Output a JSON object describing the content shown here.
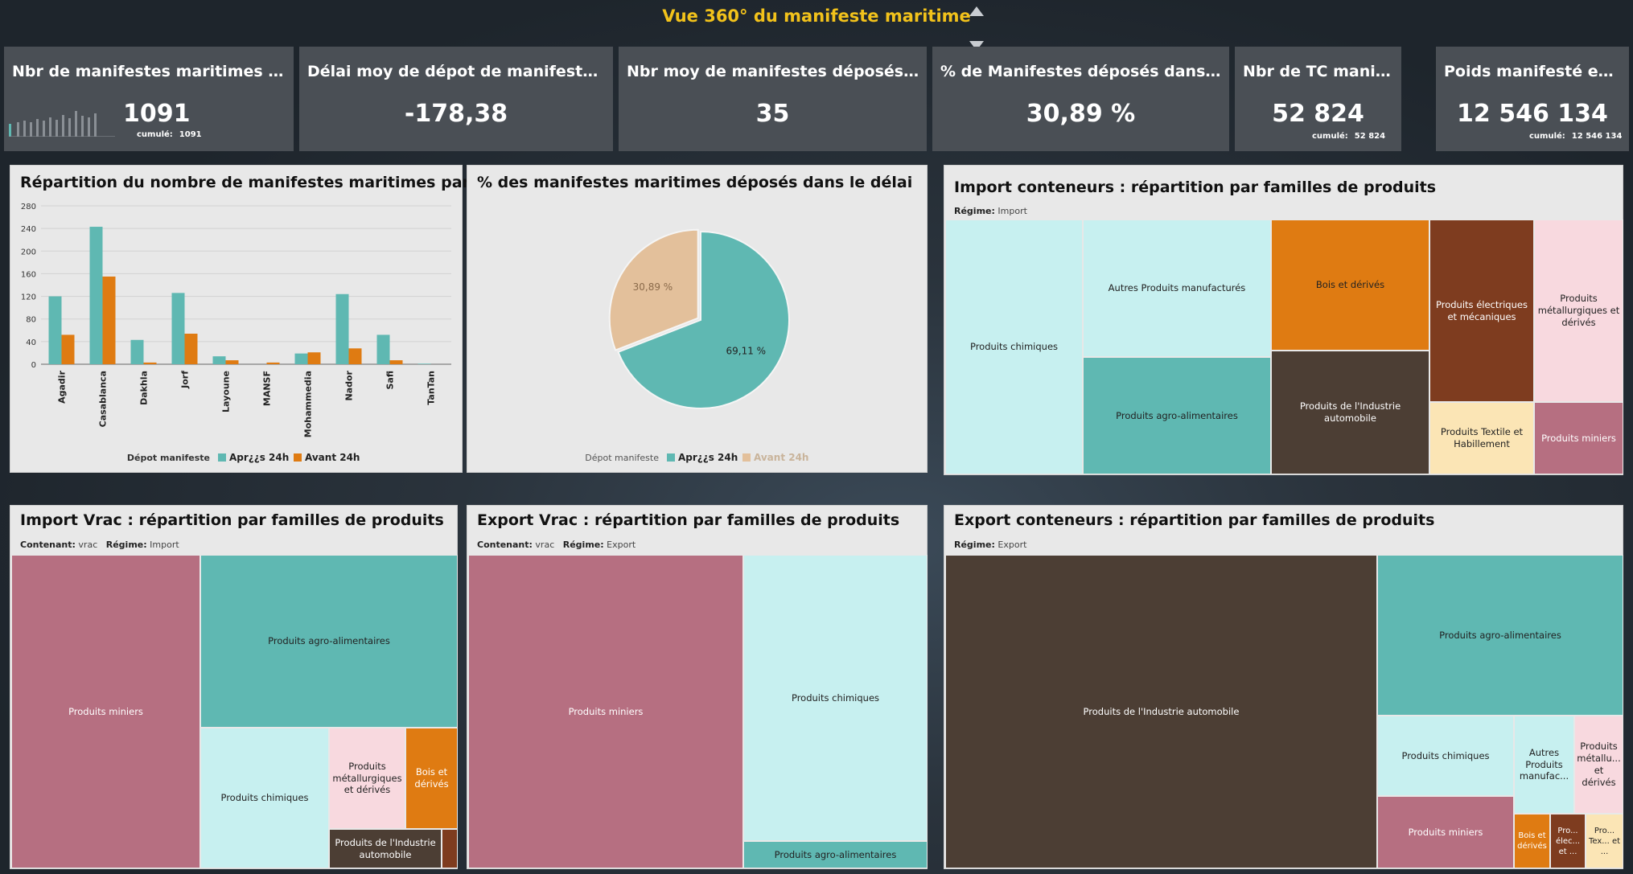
{
  "header": {
    "title": "Vue 360° du manifeste maritime"
  },
  "colors": {
    "teal": "#5fb8b2",
    "orange": "#df7b12",
    "peach": "#e3c09b",
    "pale_cyan": "#c7f0f0",
    "brown": "#7e3c1f",
    "dark_brown": "#4c3e34",
    "pink": "#f8d9df",
    "mauve": "#b66f81",
    "light_yellow": "#fbe5b5",
    "title_yellow": "#f2c21b"
  },
  "kpis": [
    {
      "title": "Nbr de manifestes maritimes dépos...",
      "value": "1091",
      "cumul_label": "cumulé:",
      "cumul_value": "1091"
    },
    {
      "title": "Délai moy de dépot de manifeste en he...",
      "value": "-178,38"
    },
    {
      "title": "Nbr moy de manifestes déposés par jo...",
      "value": "35"
    },
    {
      "title": "% de Manifestes déposés dans le délai",
      "value": "30,89 %"
    },
    {
      "title": "Nbr de TC manifestés",
      "value": "52 824",
      "cumul_label": "cumulé:",
      "cumul_value": "52 824"
    },
    {
      "title": "Poids manifesté en to...",
      "value": "12 546 134",
      "cumul_label": "cumulé:",
      "cumul_value": "12 546 134"
    }
  ],
  "bar_panel": {
    "title": "Répartition du nombre de manifestes maritimes par port",
    "legend_title": "Dépot manifeste",
    "chart_data": {
      "type": "bar",
      "categories": [
        "Agadir",
        "Casablanca",
        "Dakhla",
        "Jorf",
        "Layoune",
        "MANSF",
        "Mohammedia",
        "Nador",
        "Safi",
        "TanTan"
      ],
      "series": [
        {
          "name": "Apr¿¿s 24h",
          "values": [
            120,
            243,
            43,
            126,
            14,
            0,
            19,
            124,
            52,
            1
          ]
        },
        {
          "name": "Avant 24h",
          "values": [
            52,
            155,
            3,
            54,
            7,
            3,
            21,
            28,
            7,
            0
          ]
        }
      ],
      "yticks": [
        0,
        40,
        80,
        120,
        160,
        200,
        240,
        280
      ],
      "ylim": [
        0,
        280
      ],
      "grid": true,
      "legend": "bottom"
    }
  },
  "pie_panel": {
    "title": "% des manifestes maritimes déposés dans le délai",
    "legend_title": "Dépot manifeste",
    "chart_data": {
      "type": "pie",
      "labels": [
        "Apr¿¿s 24h",
        "Avant 24h"
      ],
      "values": [
        69.11,
        30.89
      ],
      "value_labels": [
        "69,11 %",
        "30,89 %"
      ],
      "legend": "bottom"
    }
  },
  "import_cont": {
    "title": "Import conteneurs : répartition par familles de produits",
    "filter_label": "Régime:",
    "filter_value": "Import",
    "tiles": [
      {
        "label": "Produits chimiques"
      },
      {
        "label": "Autres Produits manufacturés"
      },
      {
        "label": "Produits agro-alimentaires"
      },
      {
        "label": "Bois et dérivés"
      },
      {
        "label": "Produits de l'Industrie automobile"
      },
      {
        "label": "Produits électriques et mécaniques"
      },
      {
        "label": "Produits métallurgiques et dérivés"
      },
      {
        "label": "Produits Textile et Habillement"
      },
      {
        "label": "Produits miniers"
      }
    ]
  },
  "import_vrac": {
    "title": "Import Vrac : répartition par familles de produits",
    "filter1_label": "Contenant:",
    "filter1_value": "vrac",
    "filter2_label": "Régime:",
    "filter2_value": "Import",
    "tiles": [
      {
        "label": "Produits miniers"
      },
      {
        "label": "Produits agro-alimentaires"
      },
      {
        "label": "Produits chimiques"
      },
      {
        "label": "Produits métallurgiques et dérivés"
      },
      {
        "label": "Bois et dérivés"
      },
      {
        "label": "Produits de l'Industrie automobile"
      }
    ]
  },
  "export_vrac": {
    "title": "Export Vrac : répartition par familles de produits",
    "filter1_label": "Contenant:",
    "filter1_value": "vrac",
    "filter2_label": "Régime:",
    "filter2_value": "Export",
    "tiles": [
      {
        "label": "Produits miniers"
      },
      {
        "label": "Produits chimiques"
      },
      {
        "label": "Produits agro-alimentaires"
      }
    ]
  },
  "export_cont": {
    "title": "Export conteneurs : répartition par familles de produits",
    "filter_label": "Régime:",
    "filter_value": "Export",
    "tiles": [
      {
        "label": "Produits de l'Industrie automobile"
      },
      {
        "label": "Produits agro-alimentaires"
      },
      {
        "label": "Produits chimiques"
      },
      {
        "label": "Autres Produits manufac..."
      },
      {
        "label": "Produits métallu... et dérivés"
      },
      {
        "label": "Produits miniers"
      },
      {
        "label": "Bois et dérivés"
      },
      {
        "label": "Pro... élec... et ..."
      },
      {
        "label": "Pro... Tex... et ..."
      }
    ]
  }
}
